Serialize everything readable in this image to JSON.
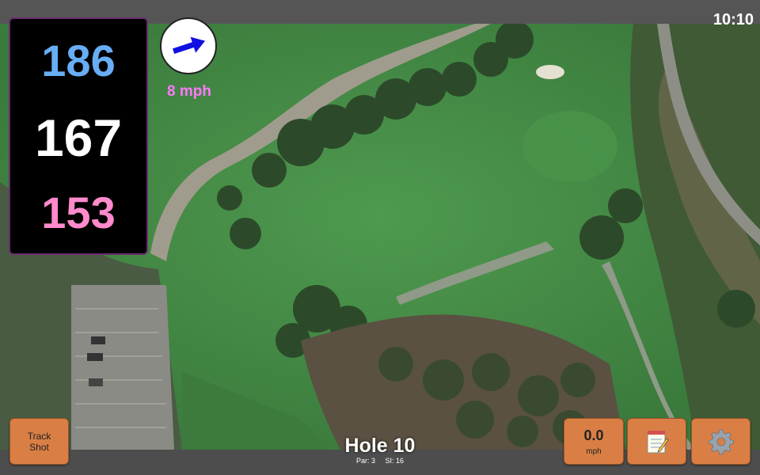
{
  "status": {
    "clock": "10:10"
  },
  "distances": {
    "back": "186",
    "middle": "167",
    "front": "153"
  },
  "wind": {
    "speed_label": "8 mph",
    "direction_icon": "arrow-icon",
    "arrow_color": "#1010e0"
  },
  "buttons": {
    "track_shot_line1": "Track",
    "track_shot_line2": "Shot",
    "speed_value": "0.0",
    "speed_unit": "mph",
    "notes_icon": "notepad-icon",
    "settings_icon": "gear-icon"
  },
  "hole": {
    "title": "Hole 10",
    "par": "Par: 3",
    "si": "SI: 16"
  },
  "colors": {
    "back": "#68aef6",
    "middle": "#ffffff",
    "front": "#ff8acc",
    "wind_label": "#ff79ff",
    "button": "#d97f45"
  }
}
